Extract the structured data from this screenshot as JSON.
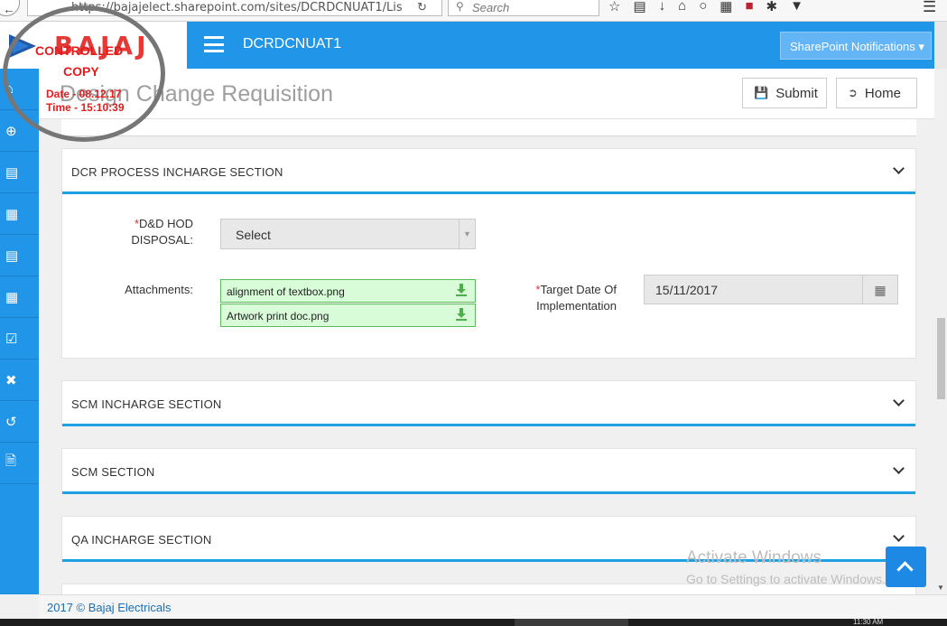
{
  "browser": {
    "url": "https://bajajelect.sharepoint.com/sites/DCRDCNUAT1/Lis",
    "search_placeholder": "Search"
  },
  "header": {
    "logo_text": "BAJAJ",
    "site_title": "DCRDCNUAT1",
    "notifications_label": "SharePoint Notifications ▾"
  },
  "page": {
    "title": "Design Change Requisition",
    "submit_label": "Submit",
    "home_label": "Home"
  },
  "sections": {
    "dcr_process": "DCR PROCESS INCHARGE SECTION",
    "scm_incharge": "SCM INCHARGE SECTION",
    "scm": "SCM SECTION",
    "qa_incharge": "QA INCHARGE SECTION"
  },
  "form": {
    "hod_label_line1": "D&D HOD",
    "hod_label_line2": "DISPOSAL:",
    "hod_value": "Select",
    "attachments_label": "Attachments:",
    "attachments": [
      "alignment of textbox.png",
      "Artwork print doc.png"
    ],
    "target_label_line1": "Target Date Of",
    "target_label_line2": "Implementation",
    "target_value": "15/11/2017"
  },
  "stamp": {
    "line1": "CONTROLLED",
    "line2": "COPY",
    "date": "Date - 08.12.17",
    "time": "Time - 15:10:39"
  },
  "watermark": {
    "line1": "Activate Windows",
    "line2": "Go to Settings to activate Windows."
  },
  "footer": {
    "text": "2017 © Bajaj Electricals"
  },
  "taskbar": {
    "clock": "11:30 AM"
  },
  "colors": {
    "brand_blue": "#2196e8",
    "accent_line": "#1ea1e2",
    "attachment_green": "#d7fcd7",
    "stamp_red": "#e21c1c"
  },
  "icons": {
    "sidebar": [
      "home-icon",
      "plus-circle-icon",
      "list-icon",
      "table-icon",
      "list-icon",
      "table-icon",
      "check-square-icon",
      "close-icon",
      "undo-icon",
      "file-icon"
    ]
  }
}
